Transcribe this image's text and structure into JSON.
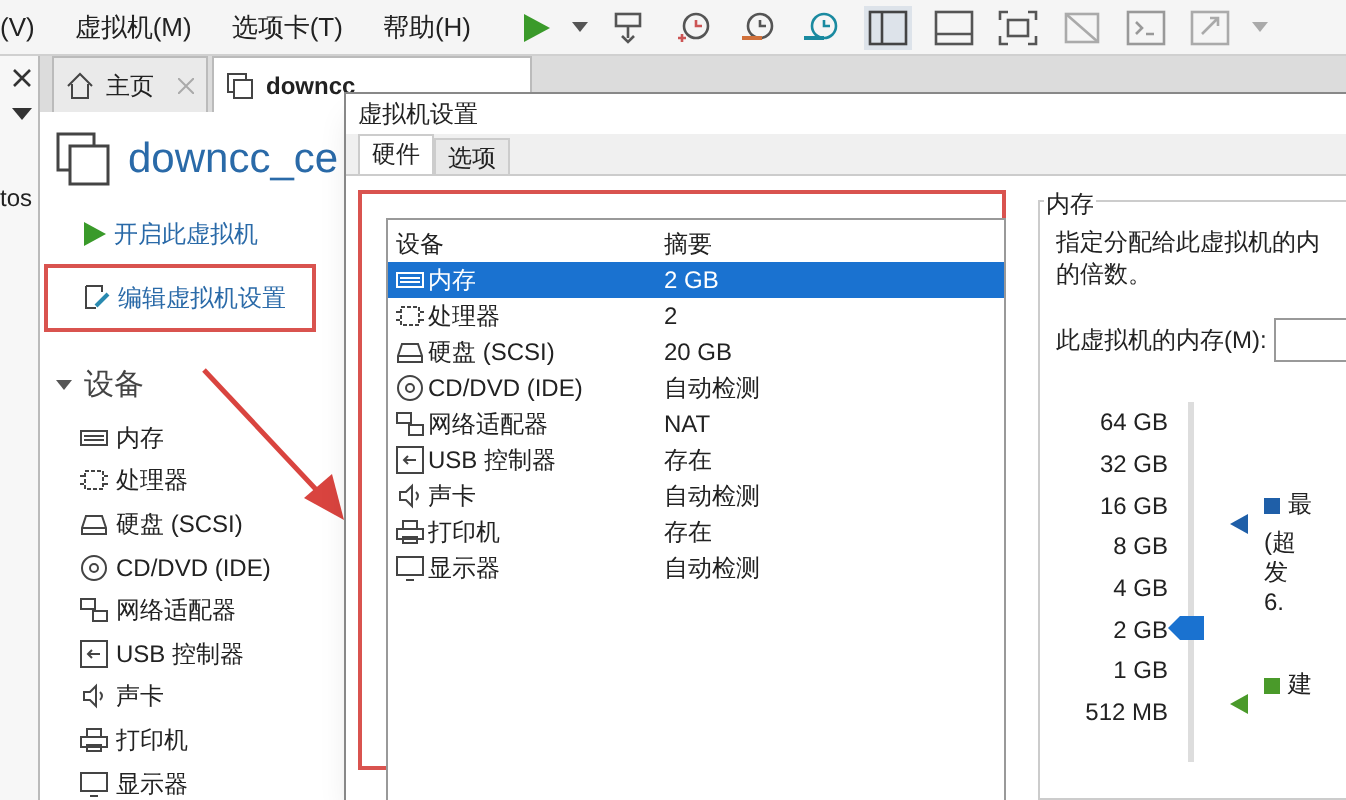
{
  "menu": [
    {
      "label": "(V)"
    },
    {
      "label": "虚拟机(M)"
    },
    {
      "label": "选项卡(T)"
    },
    {
      "label": "帮助(H)"
    }
  ],
  "side_fragment": "tos",
  "tabs": [
    {
      "label": "主页",
      "kind": "home",
      "selected": false
    },
    {
      "label": "downcc",
      "kind": "vm",
      "selected": true
    }
  ],
  "vm_title": "downcc_ce",
  "actions": [
    {
      "label": "开启此虚拟机",
      "kind": "play",
      "highlighted": false
    },
    {
      "label": "编辑虚拟机设置",
      "kind": "edit",
      "highlighted": true
    }
  ],
  "devices_section": {
    "label": "设备",
    "expanded": true
  },
  "devices": [
    {
      "label": "内存",
      "kind": "memory"
    },
    {
      "label": "处理器",
      "kind": "cpu"
    },
    {
      "label": "硬盘 (SCSI)",
      "kind": "disk"
    },
    {
      "label": "CD/DVD (IDE)",
      "kind": "cd"
    },
    {
      "label": "网络适配器",
      "kind": "net"
    },
    {
      "label": "USB 控制器",
      "kind": "usb"
    },
    {
      "label": "声卡",
      "kind": "sound"
    },
    {
      "label": "打印机",
      "kind": "printer"
    },
    {
      "label": "显示器",
      "kind": "display"
    }
  ],
  "dialog": {
    "title": "虚拟机设置",
    "tabs": [
      {
        "label": "硬件",
        "selected": true
      },
      {
        "label": "选项",
        "selected": false
      }
    ],
    "columns": [
      "设备",
      "摘要"
    ],
    "rows": [
      {
        "device": "内存",
        "kind": "memory",
        "summary": "2 GB",
        "selected": true
      },
      {
        "device": "处理器",
        "kind": "cpu",
        "summary": "2",
        "selected": false
      },
      {
        "device": "硬盘 (SCSI)",
        "kind": "disk",
        "summary": "20 GB",
        "selected": false
      },
      {
        "device": "CD/DVD (IDE)",
        "kind": "cd",
        "summary": "自动检测",
        "selected": false
      },
      {
        "device": "网络适配器",
        "kind": "net",
        "summary": "NAT",
        "selected": false
      },
      {
        "device": "USB 控制器",
        "kind": "usb",
        "summary": "存在",
        "selected": false
      },
      {
        "device": "声卡",
        "kind": "sound",
        "summary": "自动检测",
        "selected": false
      },
      {
        "device": "打印机",
        "kind": "printer",
        "summary": "存在",
        "selected": false
      },
      {
        "device": "显示器",
        "kind": "display",
        "summary": "自动检测",
        "selected": false
      }
    ],
    "memory": {
      "group_title": "内存",
      "description": [
        "指定分配给此虚拟机的内",
        "的倍数。"
      ],
      "field_label": "此虚拟机的内存(M):",
      "scale": [
        "64 GB",
        "32 GB",
        "16 GB",
        "8 GB",
        "4 GB",
        "2 GB",
        "1 GB",
        "512 MB"
      ],
      "slider": {
        "level": 0.37
      },
      "legend": [
        {
          "label": "最",
          "note": [
            "(超",
            "发",
            "6."
          ],
          "color": "#1f5fa8"
        },
        {
          "label": "建",
          "color": "#4a9a2a"
        }
      ]
    }
  }
}
